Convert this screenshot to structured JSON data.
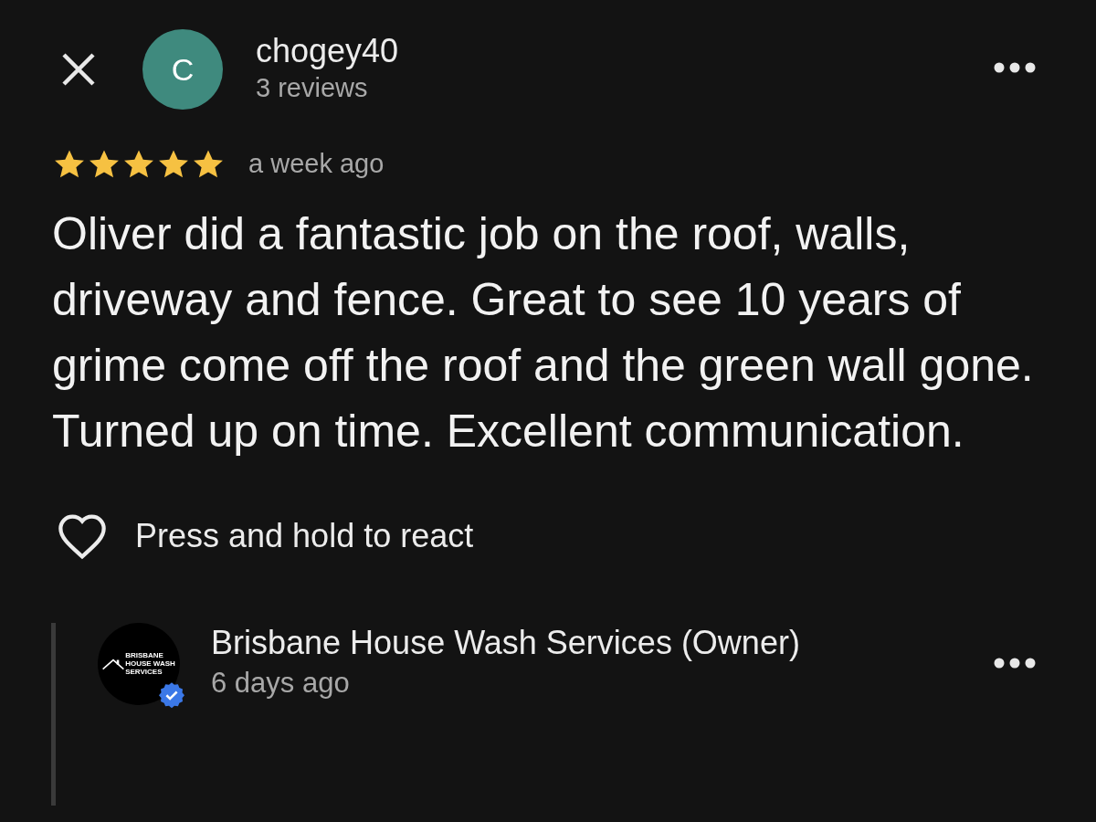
{
  "review": {
    "author": "chogey40",
    "avatar_letter": "C",
    "review_count": "3 reviews",
    "stars": 5,
    "time": "a week ago",
    "text": "Oliver did a fantastic job on the roof, walls, driveway and fence. Great to see 10 years of grime come off the roof and the green wall gone. Turned up on time. Excellent communication.",
    "react_label": "Press and hold to react"
  },
  "owner_reply": {
    "name": "Brisbane House Wash Services (Owner)",
    "time": "6 days ago",
    "verified": true,
    "logo_lines": [
      "BRISBANE",
      "HOUSE WASH",
      "SERVICES"
    ]
  }
}
